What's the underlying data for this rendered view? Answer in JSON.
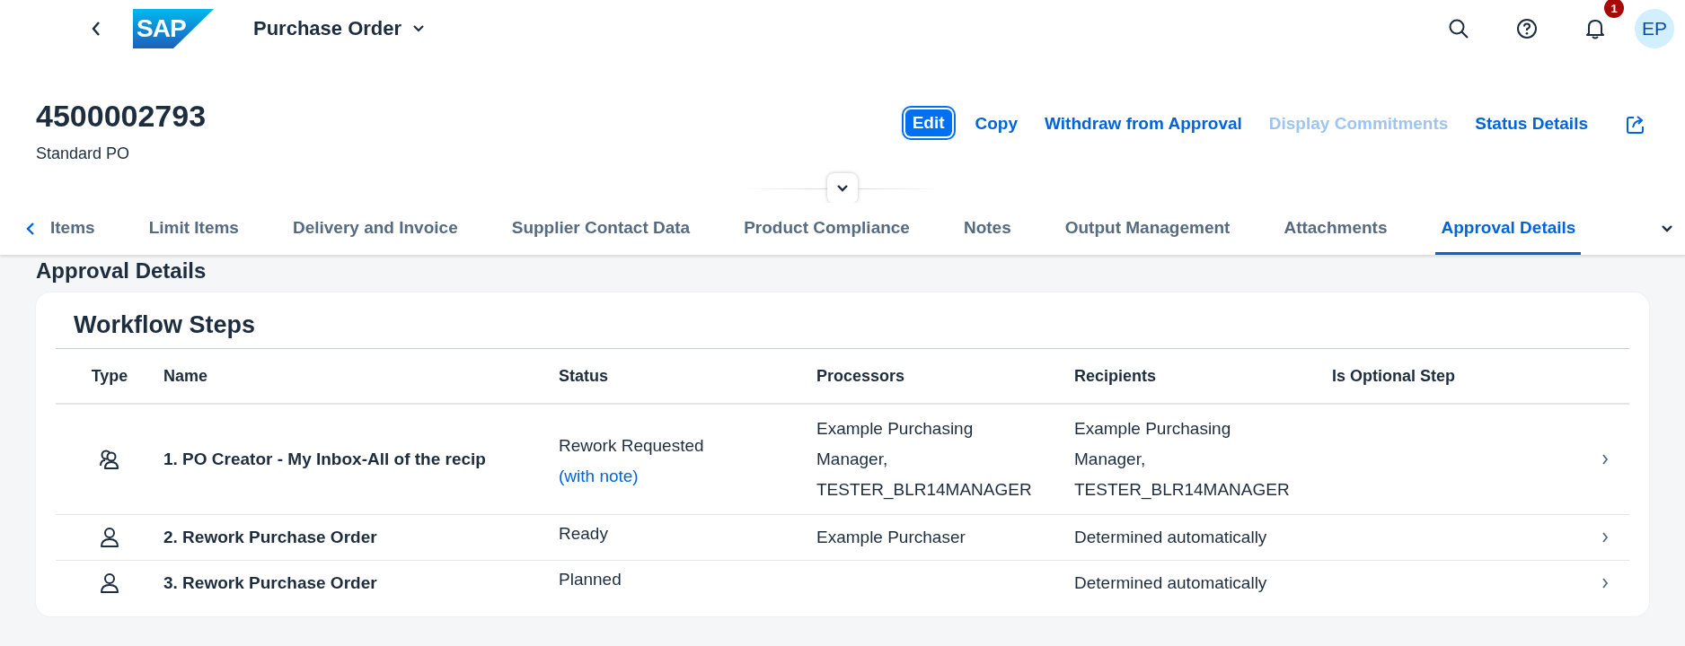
{
  "shell": {
    "logo_text": "SAP",
    "title": "Purchase Order",
    "notification_count": "1",
    "avatar_initials": "EP"
  },
  "header": {
    "object_id": "4500002793",
    "object_type": "Standard PO",
    "actions": [
      {
        "label": "Edit",
        "kind": "emphasized",
        "disabled": false
      },
      {
        "label": "Copy",
        "kind": "link",
        "disabled": false
      },
      {
        "label": "Withdraw from Approval",
        "kind": "link",
        "disabled": false
      },
      {
        "label": "Display Commitments",
        "kind": "link",
        "disabled": true
      },
      {
        "label": "Status Details",
        "kind": "link",
        "disabled": false
      }
    ]
  },
  "tabs": [
    {
      "label": "Items",
      "selected": false
    },
    {
      "label": "Limit Items",
      "selected": false
    },
    {
      "label": "Delivery and Invoice",
      "selected": false
    },
    {
      "label": "Supplier Contact Data",
      "selected": false
    },
    {
      "label": "Product Compliance",
      "selected": false
    },
    {
      "label": "Notes",
      "selected": false
    },
    {
      "label": "Output Management",
      "selected": false
    },
    {
      "label": "Attachments",
      "selected": false
    },
    {
      "label": "Approval Details",
      "selected": true
    }
  ],
  "section_title": "Approval Details",
  "workflow": {
    "title": "Workflow Steps",
    "columns": [
      "Type",
      "Name",
      "Status",
      "Processors",
      "Recipients",
      "Is Optional Step"
    ],
    "rows": [
      {
        "kind": "group",
        "name": "1. PO Creator - My Inbox-All of the recip",
        "status": "Rework Requested",
        "status_link": "(with note)",
        "processors": "Example Purchasing Manager, TESTER_BLR14MANAGER",
        "recipients": "Example Purchasing Manager, TESTER_BLR14MANAGER"
      },
      {
        "kind": "person",
        "name": "2. Rework Purchase Order",
        "status": "Ready",
        "processors": "Example Purchaser",
        "recipients": "Determined automatically"
      },
      {
        "kind": "person",
        "name": "3. Rework Purchase Order",
        "status": "Planned",
        "recipients": "Determined automatically"
      }
    ]
  }
}
